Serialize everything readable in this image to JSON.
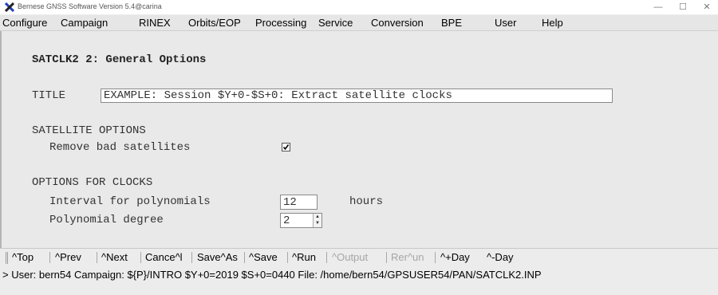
{
  "window": {
    "title": "Bernese GNSS Software Version 5.4@carina",
    "controls": {
      "minimize": "—",
      "maximize": "☐",
      "close": "✕"
    }
  },
  "menu": [
    {
      "label": "Configure"
    },
    {
      "label": "Campaign"
    },
    {
      "label": "RINEX"
    },
    {
      "label": "Orbits/EOP"
    },
    {
      "label": "Processing"
    },
    {
      "label": "Service"
    },
    {
      "label": "Conversion"
    },
    {
      "label": "BPE"
    },
    {
      "label": "User"
    },
    {
      "label": "Help"
    }
  ],
  "panel": {
    "heading": "SATCLK2 2: General Options",
    "title_label": "TITLE",
    "title_value": "EXAMPLE: Session $Y+0-$S+0: Extract satellite clocks",
    "satellite_section": "SATELLITE OPTIONS",
    "remove_bad_label": "Remove bad satellites",
    "remove_bad_checked": true,
    "clocks_section": "OPTIONS FOR CLOCKS",
    "interval_label": "Interval for polynomials",
    "interval_value": "12",
    "interval_unit": "hours",
    "degree_label": "Polynomial degree",
    "degree_value": "2"
  },
  "toolbar": {
    "top": "^Top",
    "prev": "^Prev",
    "next": "^Next",
    "cancel": "Cance^l",
    "save_as": "Save^As",
    "save": "^Save",
    "run": "^Run",
    "output": "^Output",
    "rerun": "Rer^un",
    "plus_day": "^+Day",
    "minus_day": "^-Day"
  },
  "status": {
    "line": "> User: bern54  Campaign: ${P}/INTRO  $Y+0=2019  $S+0=0440  File: /home/bern54/GPSUSER54/PAN/SATCLK2.INP"
  },
  "colors": {
    "panel_bg": "#e9e9e9",
    "toolbar_bg": "#ececec",
    "disabled_text": "#a6a6a6",
    "logo_blue": "#1f3fbf",
    "logo_dark": "#222222"
  }
}
